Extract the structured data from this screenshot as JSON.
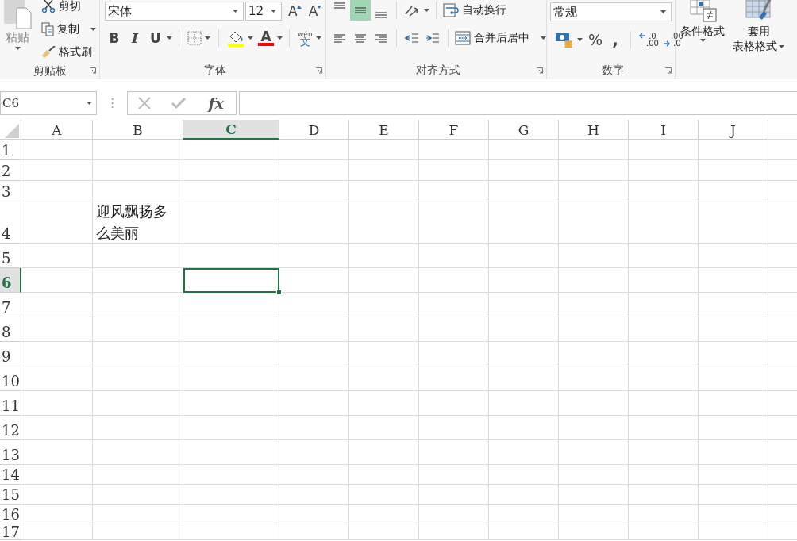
{
  "ribbon": {
    "clipboard": {
      "paste": "粘贴",
      "cut": "剪切",
      "copy": "复制",
      "format_painter": "格式刷",
      "label": "剪贴板"
    },
    "font": {
      "font_name": "宋体",
      "font_size": "12",
      "grow": "A",
      "shrink": "A",
      "bold": "B",
      "italic": "I",
      "underline": "U",
      "font_color": "A",
      "phonetic_top": "wén",
      "phonetic_bottom": "文",
      "label": "字体"
    },
    "alignment": {
      "vertical": [
        {
          "selected": false
        },
        {
          "selected": true
        },
        {
          "selected": false
        }
      ],
      "wrap_text": "自动换行",
      "merge_center": "合并后居中",
      "label": "对齐方式"
    },
    "number": {
      "format": "常规",
      "percent": "%",
      "comma": ",",
      "increase_decimal": {
        "top": ".0",
        "bottom": ".00"
      },
      "decrease_decimal": {
        "top": ".00",
        "bottom": ".0"
      },
      "label": "数字"
    },
    "styles": {
      "conditional_formatting": "条件格式",
      "format_as_table": [
        "套用",
        "表格格式"
      ]
    }
  },
  "formula_bar": {
    "name_box": "C6",
    "function_label": "fx"
  },
  "sheet": {
    "columns": [
      {
        "label": "A",
        "selected": false
      },
      {
        "label": "B",
        "selected": false
      },
      {
        "label": "C",
        "selected": true
      },
      {
        "label": "D",
        "selected": false
      },
      {
        "label": "E",
        "selected": false
      },
      {
        "label": "F",
        "selected": false
      },
      {
        "label": "G",
        "selected": false
      },
      {
        "label": "H",
        "selected": false
      },
      {
        "label": "I",
        "selected": false
      },
      {
        "label": "J",
        "selected": false
      }
    ],
    "rows": [
      {
        "label": "1",
        "selected": false
      },
      {
        "label": "2",
        "selected": false
      },
      {
        "label": "3",
        "selected": false
      },
      {
        "label": "4",
        "selected": false,
        "cells": [
          null,
          "迎风飘扬多么美丽"
        ]
      },
      {
        "label": "5",
        "selected": false
      },
      {
        "label": "6",
        "selected": true
      },
      {
        "label": "7",
        "selected": false
      },
      {
        "label": "8",
        "selected": false
      },
      {
        "label": "9",
        "selected": false
      },
      {
        "label": "10",
        "selected": false
      },
      {
        "label": "11",
        "selected": false
      },
      {
        "label": "12",
        "selected": false
      },
      {
        "label": "13",
        "selected": false
      },
      {
        "label": "14",
        "selected": false
      },
      {
        "label": "15",
        "selected": false
      },
      {
        "label": "16",
        "selected": false
      },
      {
        "label": "17",
        "selected": false
      }
    ]
  }
}
